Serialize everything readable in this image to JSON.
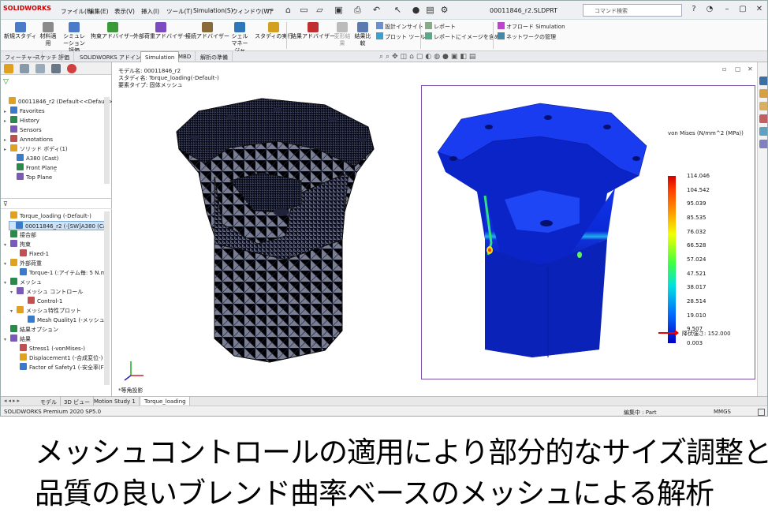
{
  "menubar": {
    "logo": "SOLIDWORKS",
    "menus": [
      "ファイル(F)",
      "編集(E)",
      "表示(V)",
      "挿入(I)",
      "ツール(T)",
      "Simulation(S)",
      "ウィンドウ(W)"
    ],
    "doc_title": "00011846_r2.SLDPRT",
    "search_placeholder": "コマンド検索"
  },
  "ribbon": {
    "buttons": [
      "新規スタディ",
      "材料適用",
      "シミュレーション評価",
      "拘束アドバイザー",
      "外部荷重アドバイザー",
      "接続アドバイザー",
      "シェルマネージャ",
      "スタディの実行",
      "結果アドバイザー",
      "変形結果",
      "結果比較"
    ],
    "small": [
      "設計インサイト",
      "プロット ツール",
      "レポート",
      "レポートにイメージを含める",
      "オフロード Simulation",
      "ネットワークの管理"
    ]
  },
  "command_tabs": [
    "フィーチャー",
    "スケッチ",
    "評価",
    "SOLIDWORKS アドイン",
    "Simulation",
    "MBD",
    "解析の準備"
  ],
  "active_command_tab": "Simulation",
  "tree_top": [
    {
      "label": "00011846_r2  (Default<<Default>_",
      "exp": ""
    },
    {
      "label": "Favorites",
      "exp": "▸"
    },
    {
      "label": "History",
      "exp": "▸"
    },
    {
      "label": "Sensors",
      "exp": ""
    },
    {
      "label": "Annotations",
      "exp": "▸"
    },
    {
      "label": "ソリッド ボディ(1)",
      "exp": "▸"
    },
    {
      "label": "A380 (Cast)",
      "exp": ""
    },
    {
      "label": "Front Plane",
      "exp": ""
    },
    {
      "label": "Top Plane",
      "exp": ""
    }
  ],
  "tree_sim": [
    {
      "label": "Torque_loading (-Default-)",
      "exp": ""
    },
    {
      "label": "00011846_r2 (-[SW]A380 (Ca",
      "exp": "",
      "selected": true
    },
    {
      "label": "接合部",
      "exp": ""
    },
    {
      "label": "拘束",
      "exp": "▾"
    },
    {
      "label": "Fixed-1",
      "exp": ""
    },
    {
      "label": "外部荷重",
      "exp": "▾"
    },
    {
      "label": "Torque-1 (:アイテム毎: 5 N.m:)",
      "exp": ""
    },
    {
      "label": "メッシュ",
      "exp": "▾"
    },
    {
      "label": "メッシュ コントロール",
      "exp": "▾"
    },
    {
      "label": "Control-1",
      "exp": ""
    },
    {
      "label": "メッシュ特性プロット",
      "exp": "▾"
    },
    {
      "label": "Mesh Quality1 (-メッシュ-)",
      "exp": ""
    },
    {
      "label": "結果オプション",
      "exp": ""
    },
    {
      "label": "結果",
      "exp": "▾"
    },
    {
      "label": "Stress1 (-vonMises-)",
      "exp": ""
    },
    {
      "label": "Displacement1 (-合成変位-)",
      "exp": ""
    },
    {
      "label": "Factor of Safety1 (-安全率(FO",
      "exp": ""
    }
  ],
  "viewport": {
    "model_name": "モデル名: 00011846_r2",
    "study_name": "スタディ名: Torque_loading(-Default-)",
    "element_type": "要素タイプ: 固体メッシュ",
    "projection": "*等角投影"
  },
  "legend": {
    "title": "von Mises (N/mm^2 (MPa))",
    "ticks": [
      "114.046",
      "104.542",
      "95.039",
      "85.535",
      "76.032",
      "66.528",
      "57.024",
      "47.521",
      "38.017",
      "28.514",
      "19.010",
      "9.507",
      "0.003"
    ],
    "yield": "降伏強さ: 152.000"
  },
  "bottom_tabs": [
    "モデル",
    "3D ビュー",
    "Motion Study 1",
    "Torque_loading"
  ],
  "active_bottom_tab": "Torque_loading",
  "status": {
    "left": "SOLIDWORKS Premium 2020 SP5.0",
    "editing": "編集中 : Part",
    "units": "MMGS"
  },
  "caption": {
    "line1": "メッシュコントロールの適用により部分的なサイズ調整と",
    "line2": "品質の良いブレンド曲率ベースのメッシュによる解析"
  },
  "colors": {
    "accent": "#1e5fc8",
    "frame": "#7a4fa8",
    "mesh": "#1a1a40",
    "stress_low": "#0a28e6"
  }
}
